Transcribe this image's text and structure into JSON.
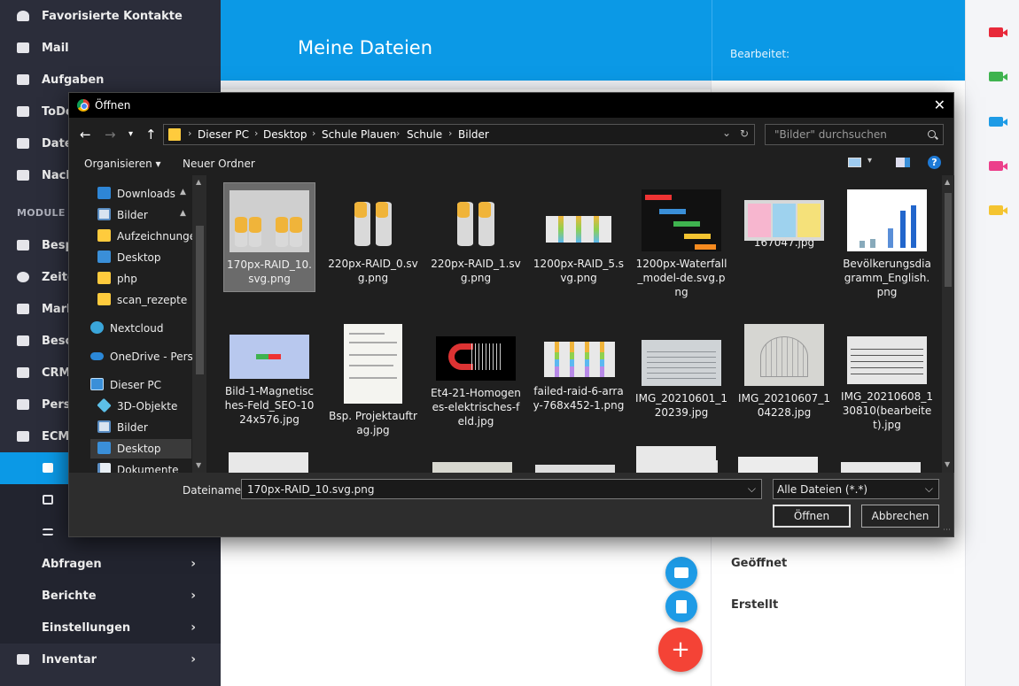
{
  "sidebar": {
    "items": [
      {
        "label": "Favorisierte Kontakte"
      },
      {
        "label": "Mail"
      },
      {
        "label": "Aufgaben"
      },
      {
        "label": "ToDo"
      },
      {
        "label": "Dateien"
      },
      {
        "label": "Nachrichten"
      },
      {
        "label": "Besprechungen"
      },
      {
        "label": "Zeiterfassung"
      },
      {
        "label": "Marketing"
      },
      {
        "label": "Beschaffung"
      },
      {
        "label": "CRM"
      },
      {
        "label": "Personal"
      },
      {
        "label": "ECM"
      }
    ],
    "section_label": "MODULE",
    "bottom_items": [
      {
        "label": "Abfragen",
        "chevron": "›"
      },
      {
        "label": "Berichte",
        "chevron": "›"
      },
      {
        "label": "Einstellungen",
        "chevron": "›"
      },
      {
        "label": "Inventar",
        "chevron": "›"
      }
    ]
  },
  "header": {
    "title": "Meine Dateien",
    "edited_label": "Bearbeitet:"
  },
  "detail": {
    "opened_label": "Geöffnet",
    "created_label": "Erstellt"
  },
  "fab": {
    "add_symbol": "+"
  },
  "colors": {
    "accent": "#0b99e6",
    "fab_red": "#f44336",
    "video_icons": [
      "#e8293a",
      "#3fb34f",
      "#1e9be6",
      "#ec3f8b",
      "#f4c431"
    ]
  },
  "dialog": {
    "title": "Öffnen",
    "close_symbol": "✕",
    "breadcrumbs": [
      "Dieser PC",
      "Desktop",
      "Schule Plauen",
      "Schule",
      "Bilder"
    ],
    "search_placeholder": "\"Bilder\" durchsuchen",
    "toolbar": {
      "organize": "Organisieren",
      "organize_arrow": "▾",
      "new_folder": "Neuer Ordner"
    },
    "nav_items": [
      {
        "label": "Downloads",
        "icon": "download-icon",
        "pinned": true
      },
      {
        "label": "Bilder",
        "icon": "pictures-icon",
        "pinned": true
      },
      {
        "label": "Aufzeichnungen",
        "icon": "folder-icon"
      },
      {
        "label": "Desktop",
        "icon": "desktop-icon"
      },
      {
        "label": "php",
        "icon": "folder-icon"
      },
      {
        "label": "scan_rezepte",
        "icon": "folder-icon"
      },
      {
        "label": "Nextcloud",
        "icon": "nextcloud-icon"
      },
      {
        "label": "OneDrive - Persor",
        "icon": "onedrive-icon"
      },
      {
        "label": "Dieser PC",
        "icon": "pc-icon"
      },
      {
        "label": "3D-Objekte",
        "icon": "3d-objects-icon"
      },
      {
        "label": "Bilder",
        "icon": "pictures-icon"
      },
      {
        "label": "Desktop",
        "icon": "desktop-icon",
        "selected": true
      },
      {
        "label": "Dokumente",
        "icon": "documents-icon"
      }
    ],
    "files": [
      {
        "name": "170px-RAID_10.svg.png",
        "selected": true,
        "thumb": "raid10"
      },
      {
        "name": "220px-RAID_0.svg.png",
        "thumb": "raid2"
      },
      {
        "name": "220px-RAID_1.svg.png",
        "thumb": "raid2"
      },
      {
        "name": "1200px-RAID_5.svg.png",
        "thumb": "raid5"
      },
      {
        "name": "1200px-Waterfall_model-de.svg.png",
        "thumb": "waterfall"
      },
      {
        "name": "167047.jpg",
        "thumb": "cards"
      },
      {
        "name": "Bevölkerungsdiagramm_English.png",
        "thumb": "barchart"
      },
      {
        "name": "Bild-1-Magnetisches-Feld_SEO-1024x576.jpg",
        "thumb": "magnet"
      },
      {
        "name": "Bsp. Projektauftrag.jpg",
        "thumb": "doc"
      },
      {
        "name": "Et4-21-Homogenes-elektrisches-feld.jpg",
        "thumb": "horseshoe"
      },
      {
        "name": "failed-raid-6-array-768x452-1.png",
        "thumb": "raid6"
      },
      {
        "name": "IMG_20210601_120239.jpg",
        "thumb": "photo1"
      },
      {
        "name": "IMG_20210607_104228.jpg",
        "thumb": "photo2"
      },
      {
        "name": "IMG_20210608_130810(bearbeitet).jpg",
        "thumb": "photo3"
      }
    ],
    "filename_label": "Dateiname:",
    "filename_value": "170px-RAID_10.svg.png",
    "filetype_value": "Alle Dateien (*.*)",
    "open_button": "Öffnen",
    "cancel_button": "Abbrechen",
    "dropdown_symbol": "⌵"
  }
}
